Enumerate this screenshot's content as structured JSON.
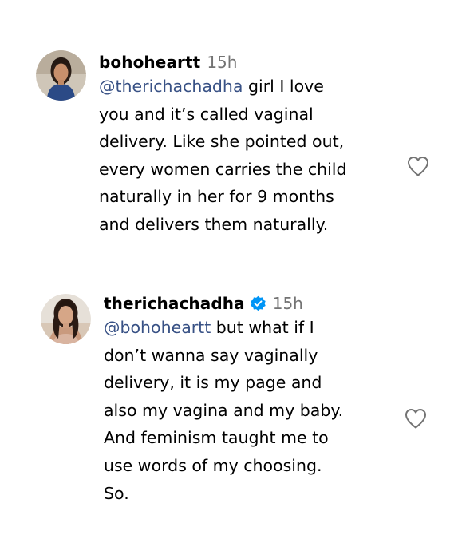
{
  "comments": [
    {
      "username": "bohoheartt",
      "timestamp": "15h",
      "verified": false,
      "mention": "@therichachadha",
      "text_first": " girl I love",
      "text_rest": "you and it’s called vaginal\ndelivery. Like she pointed out,\nevery women carries the child\nnaturally in her for 9 months\nand delivers them naturally.",
      "like_icon": "heart-outline-icon"
    },
    {
      "username": "therichachadha",
      "timestamp": "15h",
      "verified": true,
      "mention": "@bohoheartt",
      "text_first": " but what if I",
      "text_rest": "don’t wanna say vaginally\ndelivery, it is my page and\nalso my vagina and my baby.\nAnd feminism taught me to\nuse words of my choosing.\nSo.",
      "like_icon": "heart-outline-icon"
    }
  ],
  "colors": {
    "mention": "#385185",
    "timestamp": "#737373",
    "verified_badge": "#0095f6",
    "text": "#000000"
  }
}
